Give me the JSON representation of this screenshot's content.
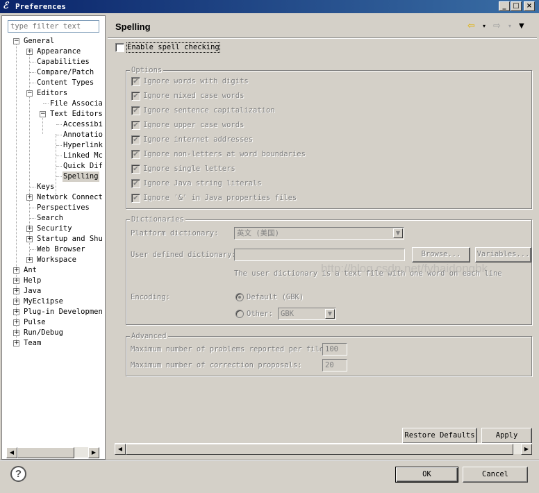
{
  "window": {
    "title": "Preferences",
    "buttons": [
      "_",
      "□",
      "×"
    ]
  },
  "filter": {
    "placeholder": "type filter text"
  },
  "tree": [
    {
      "label": "General"
    },
    {
      "label": "Appearance"
    },
    {
      "label": "Capabilities"
    },
    {
      "label": "Compare/Patch"
    },
    {
      "label": "Content Types"
    },
    {
      "label": "Editors"
    },
    {
      "label": "File Associa"
    },
    {
      "label": "Text Editors"
    },
    {
      "label": "Accessibi"
    },
    {
      "label": "Annotatio"
    },
    {
      "label": "Hyperlink"
    },
    {
      "label": "Linked Mc"
    },
    {
      "label": "Quick Dif"
    },
    {
      "label": "Spelling"
    },
    {
      "label": "Keys"
    },
    {
      "label": "Network Connect"
    },
    {
      "label": "Perspectives"
    },
    {
      "label": "Search"
    },
    {
      "label": "Security"
    },
    {
      "label": "Startup and Shu"
    },
    {
      "label": "Web Browser"
    },
    {
      "label": "Workspace"
    },
    {
      "label": "Ant"
    },
    {
      "label": "Help"
    },
    {
      "label": "Java"
    },
    {
      "label": "MyEclipse"
    },
    {
      "label": "Plug-in Developmen"
    },
    {
      "label": "Pulse"
    },
    {
      "label": "Run/Debug"
    },
    {
      "label": "Team"
    }
  ],
  "page": {
    "title": "Spelling",
    "enable_spell": "Enable spell checking",
    "options_legend": "Options",
    "options": [
      "Ignore words with digits",
      "Ignore mixed case words",
      "Ignore sentence capitalization",
      "Ignore upper case words",
      "Ignore internet addresses",
      "Ignore non-letters at word boundaries",
      "Ignore single letters",
      "Ignore Java string literals",
      "Ignore '&' in Java properties files"
    ],
    "dictionaries_legend": "Dictionaries",
    "platform_dict_label": "Platform dictionary:",
    "platform_dict_value": "英文 (美国)",
    "user_dict_label": "User defined dictionary:",
    "user_dict_value": "",
    "browse": "Browse...",
    "variables": "Variables...",
    "user_dict_note": "The user dictionary is a text file with one word on each line",
    "encoding_label": "Encoding:",
    "encoding_default": "Default (GBK)",
    "encoding_other": "Other:",
    "encoding_other_value": "GBK",
    "advanced_legend": "Advanced",
    "max_problems_label": "Maximum number of problems reported per file:",
    "max_problems_value": "100",
    "max_proposals_label": "Maximum number of correction proposals:",
    "max_proposals_value": "20",
    "restore_defaults": "Restore Defaults",
    "apply": "Apply",
    "watermark": "http://blog.csdn.net/fyhaidongbk"
  },
  "footer": {
    "ok": "OK",
    "cancel": "Cancel"
  },
  "icons": {
    "back": "back-arrow-icon",
    "forward": "forward-arrow-icon",
    "menu": "view-menu-icon",
    "help": "help-icon"
  }
}
